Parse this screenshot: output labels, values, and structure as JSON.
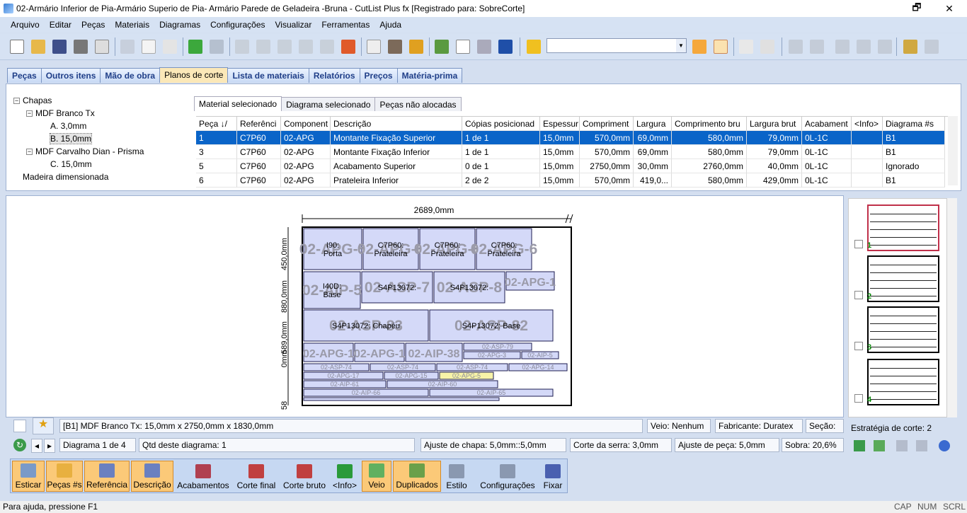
{
  "window": {
    "title": "02-Armário Inferior de Pia-Armário Superio de Pia- Armário Parede de Geladeira -Bruna - CutList Plus fx [Registrado para: SobreCorte]",
    "restore": "🗗",
    "close": "✕"
  },
  "menu": [
    "Arquivo",
    "Editar",
    "Peças",
    "Materiais",
    "Diagramas",
    "Configurações",
    "Visualizar",
    "Ferramentas",
    "Ajuda"
  ],
  "tabs": [
    "Peças",
    "Outros itens",
    "Mão de obra",
    "Planos de corte",
    "Lista de materiais",
    "Relatórios",
    "Preços",
    "Matéria-prima"
  ],
  "tree": {
    "root": "Chapas",
    "m1": "MDF Branco Tx",
    "m1a": "A. 3,0mm",
    "m1b": "B. 15,0mm",
    "m2": "MDF Carvalho Dian - Prisma",
    "m2c": "C. 15,0mm",
    "lumber": "Madeira dimensionada"
  },
  "subtabs": [
    "Material selecionado",
    "Diagrama selecionado",
    "Peças não alocadas"
  ],
  "grid": {
    "headers": [
      "Peça ↓/",
      "Referênci",
      "Component",
      "Descrição",
      "Cópias posicionad",
      "Espessur",
      "Compriment",
      "Largura",
      "Comprimento bru",
      "Largura brut",
      "Acabament",
      "<Info>",
      "Diagrama #s"
    ],
    "rows": [
      [
        "1",
        "C7P60",
        "02-APG",
        "Montante Fixação Superior",
        "1 de 1",
        "15,0mm",
        "570,0mm",
        "69,0mm",
        "580,0mm",
        "79,0mm",
        "0L-1C",
        "",
        "B1"
      ],
      [
        "3",
        "C7P60",
        "02-APG",
        "Montante Fixação Inferior",
        "1 de 1",
        "15,0mm",
        "570,0mm",
        "69,0mm",
        "580,0mm",
        "79,0mm",
        "0L-1C",
        "",
        "B1"
      ],
      [
        "5",
        "C7P60",
        "02-APG",
        "Acabamento Superior",
        "0 de 1",
        "15,0mm",
        "2750,0mm",
        "30,0mm",
        "2760,0mm",
        "40,0mm",
        "0L-1C",
        "",
        "Ignorado"
      ],
      [
        "6",
        "C7P60",
        "02-APG",
        "Prateleira Inferior",
        "2 de 2",
        "15,0mm",
        "570,0mm",
        "419,0...",
        "580,0mm",
        "429,0mm",
        "0L-1C",
        "",
        "B1"
      ]
    ]
  },
  "diagram": {
    "width_label": "2689,0mm",
    "left_labels": [
      "450,0mm",
      "880,0mm",
      "589,0mm",
      "0mm",
      "58"
    ],
    "parts": [
      {
        "label": "I90:\nPorta",
        "big": "02-APG-5"
      },
      {
        "label": "C7P60:\nPrateleira",
        "big": "02-APG-6"
      },
      {
        "label": "C7P60:\nPrateleira",
        "big": "02-APG-6"
      },
      {
        "label": "C7P60:\nPrateleira",
        "big": "02-APG-6"
      },
      {
        "label": "I40D:\nBase",
        "big": "02-AIP-5"
      },
      {
        "label": "S4P13072:",
        "big": "02-ASP-7"
      },
      {
        "label": "S4P13072:",
        "big": "02-ASP-8"
      },
      {
        "label": "",
        "big": "02-APG-1"
      },
      {
        "label": "S4P13072: Chapéu",
        "big": "02-ASP-83"
      },
      {
        "label": "S4P13072: Base",
        "big": "02-ASP-82"
      },
      {
        "label": "",
        "big": "02-APG-1"
      },
      {
        "label": "",
        "big": "02-APG-1"
      },
      {
        "label": "",
        "big": "02-AIP-38"
      }
    ],
    "small": [
      "02-ASP-79",
      "02-APG-3",
      "02-AIP-5",
      "02-ASP-74",
      "02-ASP-74",
      "02-ASP-74",
      "02-APG-14",
      "02-APG-17",
      "02-APG-15",
      "02-APG-5",
      "02-AIP-61",
      "02-AIP-60",
      "02-AIP-66",
      "02-AIP-65"
    ]
  },
  "thumbs": [
    "1",
    "2",
    "3",
    "4"
  ],
  "status": {
    "sheet_info": "[B1] MDF Branco Tx: 15,0mm x 2750,0mm x 1830,0mm",
    "grain": "Veio: Nenhum",
    "maker": "Fabricante: Duratex",
    "section": "Seção:",
    "strategy": "Estratégia de corte: 2",
    "diagram_n": "Diagrama 1 de 4",
    "qty": "Qtd deste diagrama: 1",
    "sheet_adj": "Ajuste de chapa: 5,0mm::5,0mm",
    "kerf": "Corte da serra: 3,0mm",
    "part_adj": "Ajuste de peça: 5,0mm",
    "waste": "Sobra: 20,6%"
  },
  "bottom": [
    "Esticar",
    "Peças #s",
    "Referência",
    "Descrição",
    "Acabamentos",
    "Corte final",
    "Corte bruto",
    "<Info>",
    "Veio",
    "Duplicados",
    "Estilo",
    "Configurações",
    "Fixar"
  ],
  "bottom_small": [
    "1 2 3",
    "A b"
  ],
  "help": {
    "text": "Para ajuda, pressione F1",
    "cap": "CAP",
    "num": "NUM",
    "scrl": "SCRL"
  }
}
